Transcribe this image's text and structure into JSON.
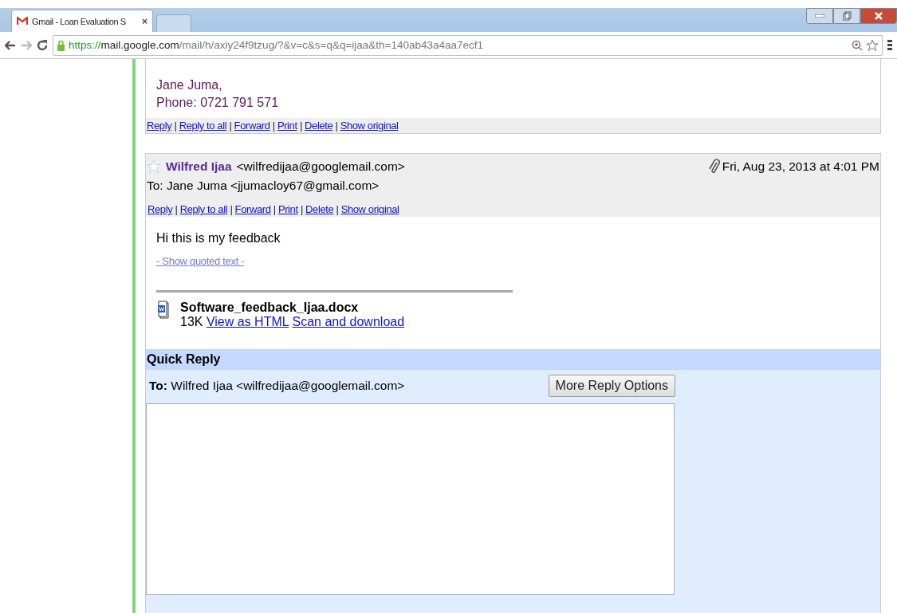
{
  "browser": {
    "tabs": [
      {
        "title": "Gmail - Loan Evaluation S",
        "close": "×",
        "selected": true
      },
      {
        "selected": false
      }
    ],
    "url": {
      "scheme": "https://",
      "host": "mail.google.com",
      "path": "/mail/h/axiy24f9tzug/?&v=c&s=q&q=ijaa&th=140ab43a4aa7ecf1"
    }
  },
  "messages": [
    {
      "kind": "tail",
      "body_lines": [
        "Jane Juma,",
        "Phone: 0721 791 571"
      ],
      "action_separator": "|",
      "actions": [
        "Reply",
        "Reply to all",
        "Forward",
        "Print",
        "Delete",
        "Show original"
      ]
    },
    {
      "kind": "full",
      "starred": false,
      "sender": "Wilfred Ijaa",
      "sender_email": "<wilfredijaa@googlemail.com>",
      "has_attachment": true,
      "date": "Fri, Aug 23, 2013 at 4:01 PM",
      "to": "To: Jane Juma <jjumacloy67@gmail.com>",
      "action_separator": "|",
      "actions": [
        "Reply",
        "Reply to all",
        "Forward",
        "Print",
        "Delete",
        "Show original"
      ],
      "body": "Hi this is my feedback",
      "quoted_link": "- Show quoted text -",
      "attachment": {
        "filename": "Software_feedback_Ijaa.docx",
        "size": "13K",
        "links": [
          "View as HTML",
          "Scan and download"
        ]
      }
    }
  ],
  "quick_reply": {
    "title": "Quick Reply",
    "to_label": "To:",
    "to_value": "Wilfred Ijaa <wilfredijaa@googlemail.com>",
    "button": "More Reply Options"
  }
}
